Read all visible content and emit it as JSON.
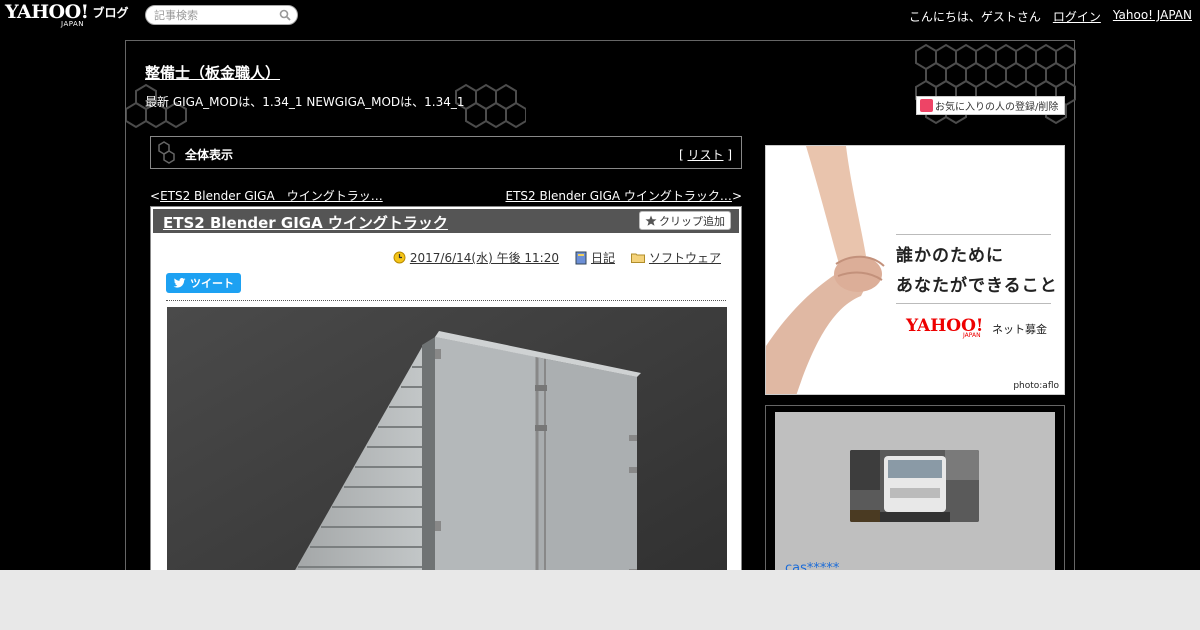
{
  "topbar": {
    "logo_text": "YAHOO!",
    "logo_japan": "JAPAN",
    "logo_blog": "ブログ",
    "search_placeholder": "記事検索",
    "greeting": "こんにちは、ゲストさん",
    "login": "ログイン",
    "yahoo_japan": "Yahoo! JAPAN"
  },
  "blog": {
    "title": "整備士（板金職人）",
    "description": "最新 GIGA_MODは、1.34_1 NEWGIGA_MODは、1.34_1",
    "favorite_label": "お気に入りの人の登録/削除"
  },
  "view": {
    "title": "全体表示",
    "list_open": "[ ",
    "list_label": "リスト",
    "list_close": " ]"
  },
  "pager": {
    "prev_arrow": "<",
    "prev_label": "ETS2 Blender GIGA　ウイングトラッ…",
    "next_label": "ETS2 Blender GIGA ウイングトラック…",
    "next_arrow": ">"
  },
  "article": {
    "title": "ETS2 Blender GIGA ウイングトラック",
    "clip_label": "クリップ追加",
    "date": "2017/6/14(水) 午後 11:20",
    "category_diary": "日記",
    "category_software": "ソフトウェア",
    "tweet_label": "ツイート"
  },
  "ad": {
    "line1": "誰かのために",
    "line2": "あなたができること",
    "logo": "YAHOO!",
    "logo_japan": "JAPAN",
    "service": "ネット募金",
    "credit": "photo:aflo"
  },
  "profile": {
    "name": "cas*****"
  },
  "colors": {
    "background": "#000000",
    "article_header": "#555555",
    "tweet_blue": "#1da1f2",
    "profile_link": "#1a6bd8",
    "ad_red": "#ee0000"
  },
  "icons": {
    "search": "magnifier-icon",
    "clock": "clock-icon",
    "diary": "notebook-icon",
    "folder": "folder-icon",
    "star": "star-icon",
    "twitter": "twitter-bird-icon",
    "favorite": "heart-badge-icon"
  }
}
